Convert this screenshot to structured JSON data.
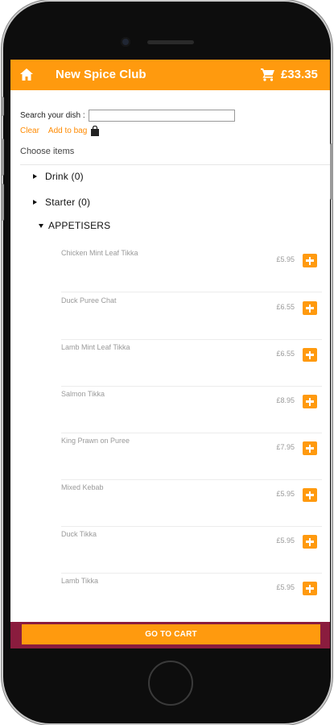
{
  "header": {
    "title": "New Spice Club",
    "cart_total": "£33.35"
  },
  "search": {
    "label": "Search your dish :",
    "value": "",
    "placeholder": ""
  },
  "actions": {
    "clear": "Clear",
    "add_to_bag": "Add to bag"
  },
  "choose_label": "Choose items",
  "categories": [
    {
      "label": "Drink (0)",
      "expanded": false
    },
    {
      "label": "Starter (0)",
      "expanded": false
    },
    {
      "label": "APPETISERS",
      "expanded": true
    }
  ],
  "items": [
    {
      "name": "Chicken Mint Leaf Tikka",
      "price": "£5.95"
    },
    {
      "name": "Duck Puree Chat",
      "price": "£6.55"
    },
    {
      "name": "Lamb Mint Leaf Tikka",
      "price": "£6.55"
    },
    {
      "name": "Salmon Tikka",
      "price": "£8.95"
    },
    {
      "name": "King Prawn on Puree",
      "price": "£7.95"
    },
    {
      "name": "Mixed Kebab",
      "price": "£5.95"
    },
    {
      "name": "Duck Tikka",
      "price": "£5.95"
    },
    {
      "name": "Lamb Tikka",
      "price": "£5.95"
    }
  ],
  "footer": {
    "go_to_cart": "GO TO CART"
  },
  "colors": {
    "accent": "#ff9a0e",
    "footer_bar": "#8a1c3e",
    "link": "#ff8a00"
  }
}
